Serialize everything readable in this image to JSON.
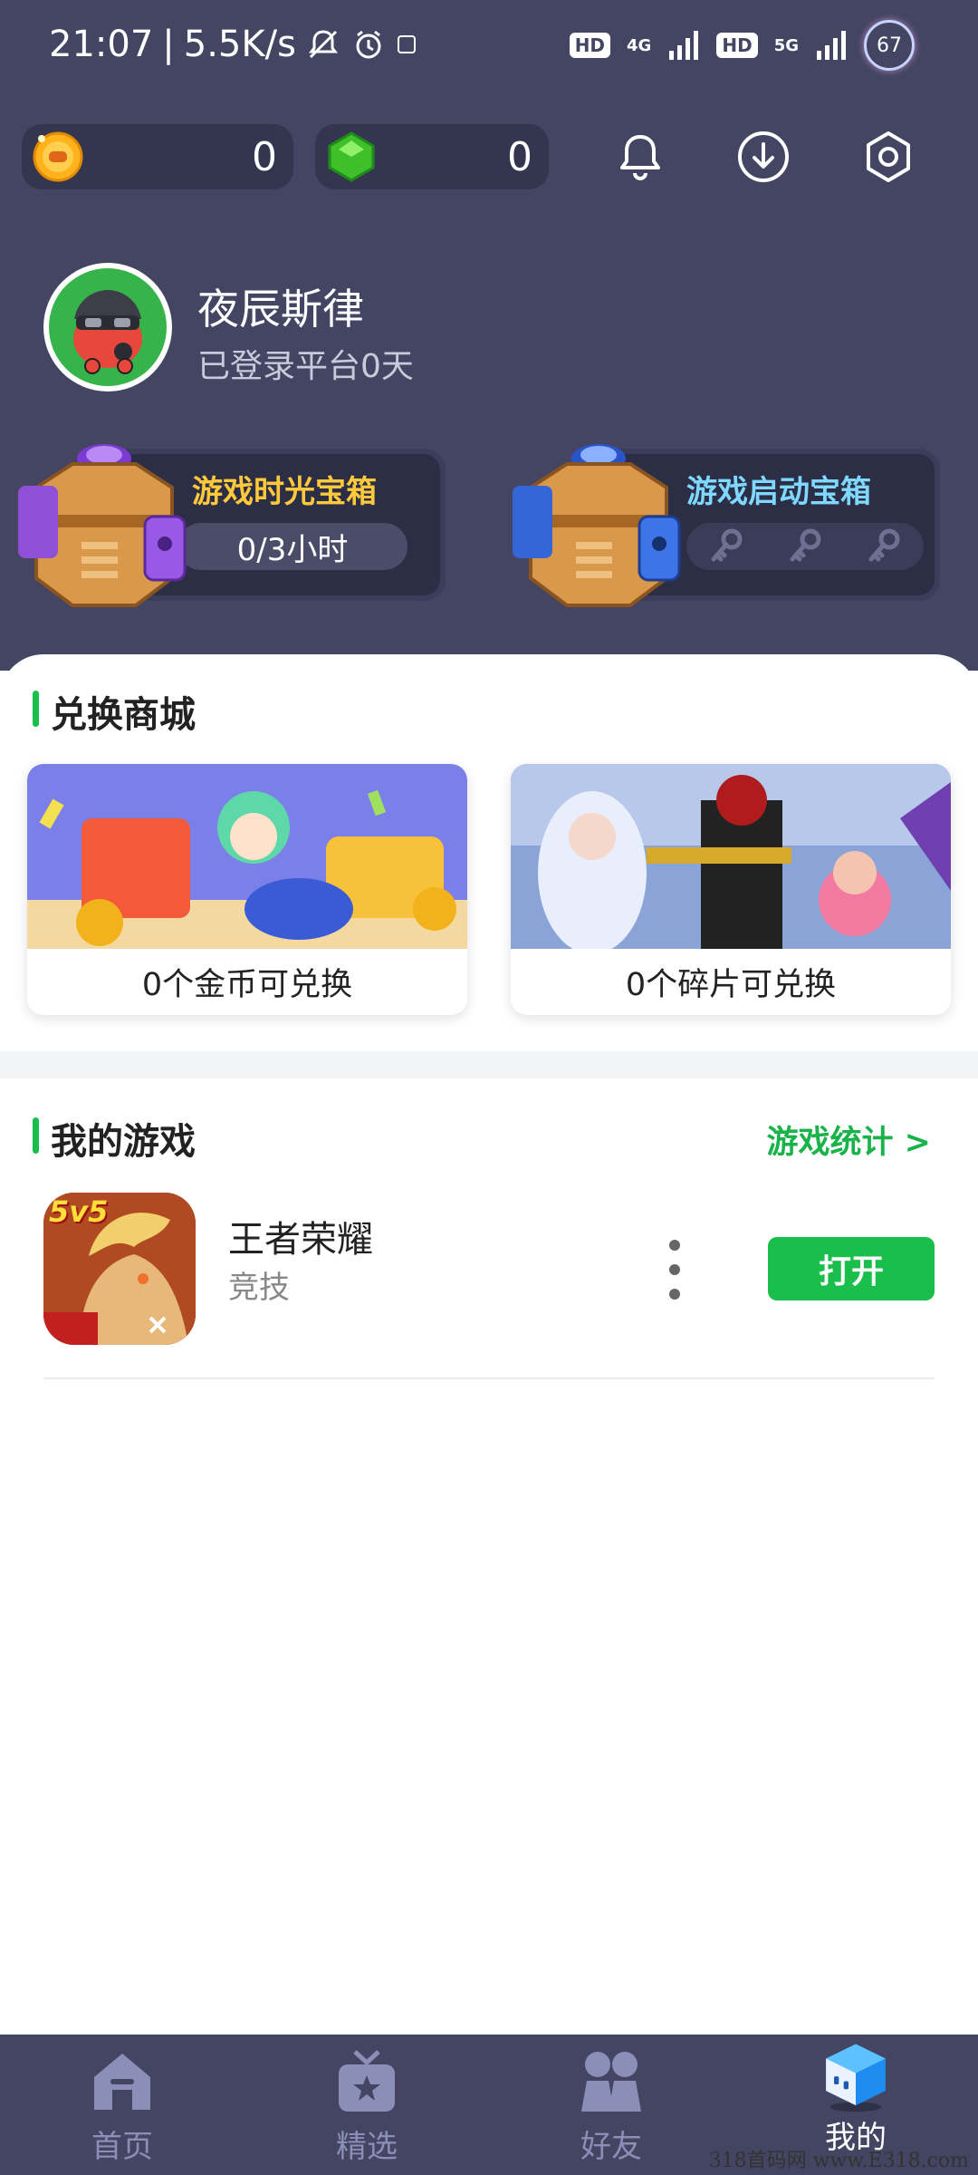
{
  "status_bar": {
    "time": "21:07",
    "speed": "5.5K/s",
    "net1": "4G",
    "net2": "5G",
    "hd": "HD",
    "battery": "67"
  },
  "header": {
    "coins_value": "0",
    "gems_value": "0",
    "icons": [
      "bell-icon",
      "download-icon",
      "gear-icon"
    ]
  },
  "profile": {
    "name": "夜辰斯律",
    "login_text": "已登录平台0天"
  },
  "chests": [
    {
      "title": "游戏时光宝箱",
      "progress": "0/3小时",
      "title_color": "#ffc93c"
    },
    {
      "title": "游戏启动宝箱",
      "keys": 3,
      "title_color": "#7fd8ff"
    }
  ],
  "exchange": {
    "title": "兑换商城",
    "cards": [
      {
        "label": "0个金币可兑换"
      },
      {
        "label": "0个碎片可兑换"
      }
    ]
  },
  "my_games": {
    "title": "我的游戏",
    "stats_link": "游戏统计 >",
    "games": [
      {
        "name": "王者荣耀",
        "category": "竞技",
        "badge": "5v5",
        "open_label": "打开"
      }
    ]
  },
  "tabbar": {
    "tabs": [
      {
        "label": "首页",
        "icon": "home-icon"
      },
      {
        "label": "精选",
        "icon": "featured-icon"
      },
      {
        "label": "好友",
        "icon": "friends-icon"
      },
      {
        "label": "我的",
        "icon": "mine-icon",
        "active": true
      }
    ]
  },
  "watermark": "318首码网 www.E318.com",
  "colors": {
    "bg_dark": "#434562",
    "accent_green": "#19be4b"
  }
}
